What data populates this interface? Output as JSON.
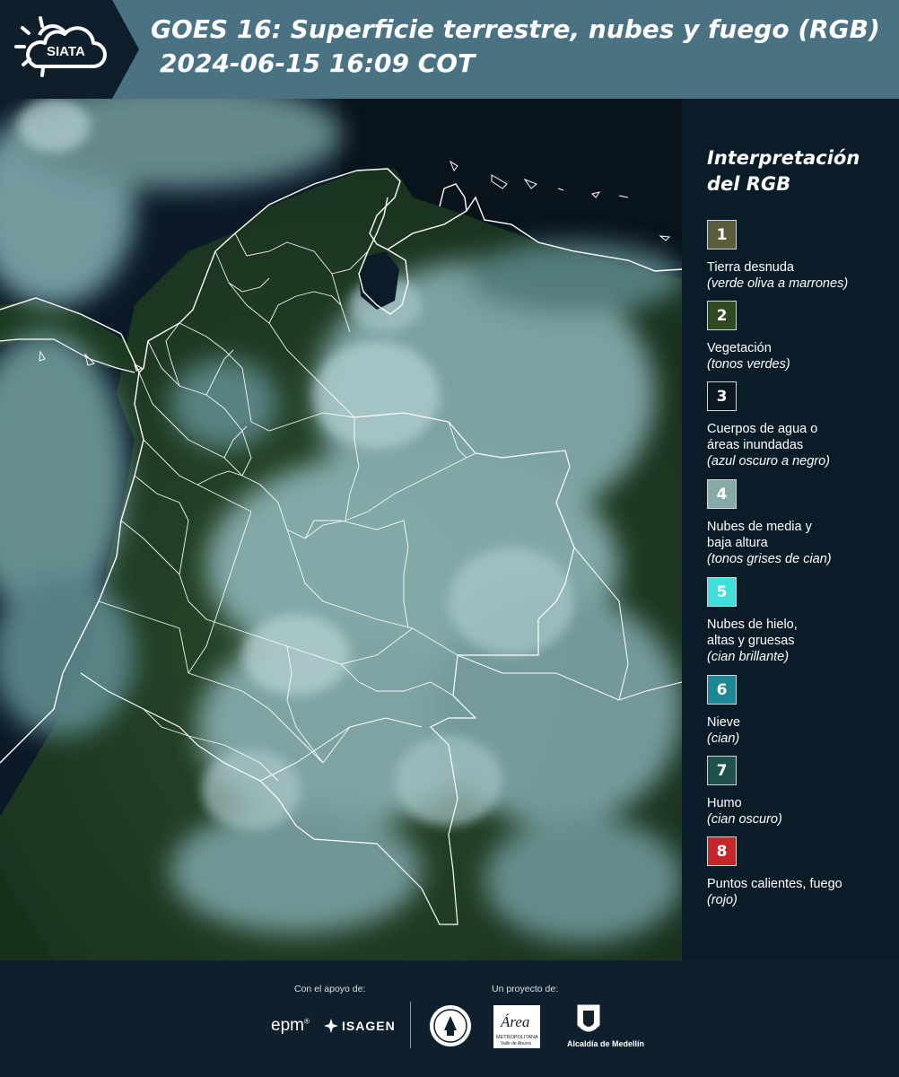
{
  "header": {
    "logo_text": "SIATA",
    "title_line1": "GOES 16: Superficie terrestre, nubes y fuego (RGB)",
    "title_line2": "2024-06-15 16:09 COT"
  },
  "legend": {
    "title": "Interpretación del RGB",
    "items": [
      {
        "number": "1",
        "color": "#5b5c3b",
        "label": "Tierra desnuda",
        "note": "(verde oliva a marrones)"
      },
      {
        "number": "2",
        "color": "#2e4a1e",
        "label": "Vegetación",
        "note": "(tonos verdes)"
      },
      {
        "number": "3",
        "color": "#0c1823",
        "label_line1": "Cuerpos de agua o",
        "label_line2": "áreas inundadas",
        "note": "(azul oscuro a negro)"
      },
      {
        "number": "4",
        "color": "#86aaa8",
        "label_line1": "Nubes de media y",
        "label_line2": "baja altura",
        "note": "(tonos grises de cian)"
      },
      {
        "number": "5",
        "color": "#3fe0dc",
        "label_line1": "Nubes de hielo,",
        "label_line2": "altas y gruesas",
        "note": "(cian brillante)"
      },
      {
        "number": "6",
        "color": "#1d8797",
        "label": "Nieve",
        "note": "(cian)"
      },
      {
        "number": "7",
        "color": "#21514f",
        "label": "Humo",
        "note": "(cian oscuro)"
      },
      {
        "number": "8",
        "color": "#c4262a",
        "label": "Puntos calientes, fuego",
        "note": "(rojo)"
      }
    ]
  },
  "footer": {
    "support_caption": "Con el apoyo de:",
    "project_caption": "Un proyecto de:",
    "epm_text": "epm",
    "isagen_text": "ISAGEN",
    "area_text": "Área",
    "area_sub1": "METROPOLITANA",
    "area_sub2": "Valle de Aburrá",
    "alcaldia_text": "Alcaldía de Medellín"
  },
  "colors": {
    "header_bg": "#4a7282",
    "logo_bg": "#0e1e2b",
    "page_bg": "#0e1e2b",
    "ocean": "#0a1824",
    "vegetation": "#1f3a1e",
    "cloud": "#8fb2b4",
    "border_line": "#ffffff"
  }
}
